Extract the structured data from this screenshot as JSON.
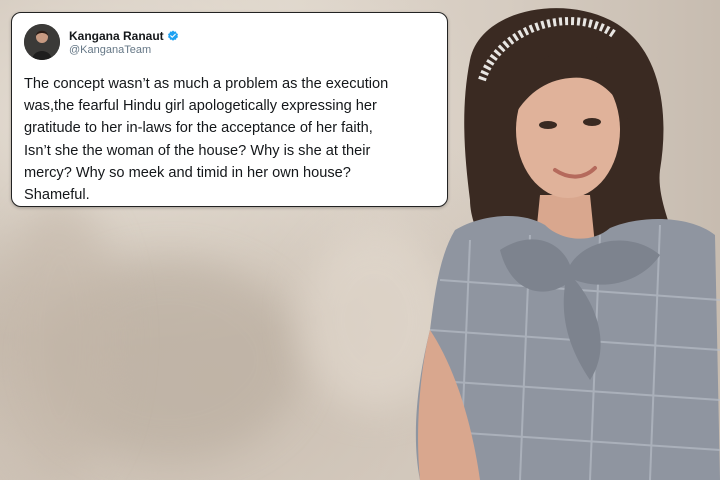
{
  "tweet": {
    "display_name": "Kangana Ranaut",
    "handle": "@KanganaTeam",
    "text": "The concept wasn’t as much a problem as the execution\nwas,the fearful Hindu girl apologetically expressing her\ngratitude to her in-laws for the acceptance of her faith,\nIsn’t she the woman of the house? Why is she at their\nmercy? Why so meek and timid in her own house?\nShameful.",
    "verified_color": "#1da1f2"
  },
  "icons": {
    "verified": "verified-badge-icon",
    "avatar": "profile-photo"
  }
}
